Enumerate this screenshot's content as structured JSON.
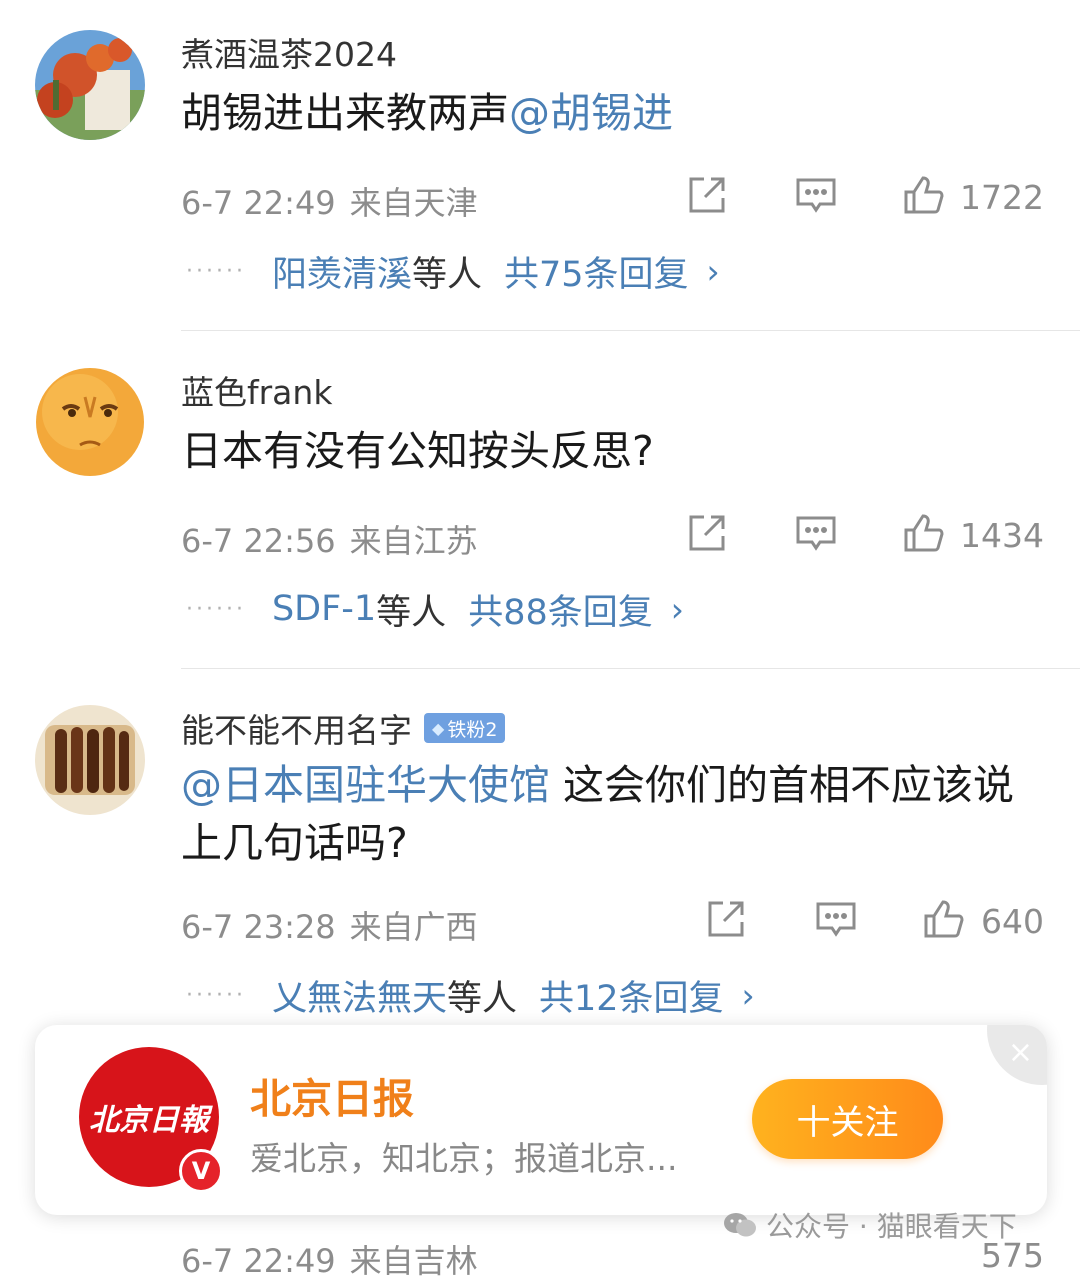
{
  "comments": [
    {
      "username": "煮酒温茶2024",
      "text": "胡锡进出来教两声",
      "mention": "@胡锡进",
      "time": "6-7 22:49",
      "location": "来自天津",
      "likes": "1722",
      "reply_names": "阳羡清溪",
      "reply_others": "等人",
      "reply_count": "共75条回复",
      "avatar": "flower-wall"
    },
    {
      "username": "蓝色frank",
      "text": "日本有没有公知按头反思?",
      "time": "6-7 22:56",
      "location": "来自江苏",
      "likes": "1434",
      "reply_names": "SDF-1",
      "reply_others": "等人",
      "reply_count": "共88条回复",
      "avatar": "orange-face"
    },
    {
      "username": "能不能不用名字",
      "badge": "铁粉2",
      "mention": "@日本国驻华大使馆",
      "text": " 这会你们的首相不应该说上几句话吗?",
      "time": "6-7 23:28",
      "location": "来自广西",
      "likes": "640",
      "reply_names": "乂無法無天",
      "reply_others": "等人",
      "reply_count": "共12条回复",
      "avatar": "food"
    }
  ],
  "reply_dots": "······",
  "reply_chevron": "›",
  "banner": {
    "logo_text": "北京日報",
    "verified_mark": "V",
    "name": "北京日报",
    "description": "爱北京，知北京；报道北京...",
    "follow_label": "十关注",
    "close": "×"
  },
  "watermark": "公众号 · 猫眼看天下",
  "peek": {
    "time": "6-7 22:49",
    "location": "来自吉林",
    "likes": "575"
  },
  "colors": {
    "mention": "#4a7fb5",
    "brand": "#f0801a",
    "follow": "#ff9a1a",
    "logo": "#d7141a"
  },
  "icons": [
    "share-icon",
    "comment-icon",
    "like-icon",
    "badge-diamond-icon",
    "wechat-icon"
  ]
}
